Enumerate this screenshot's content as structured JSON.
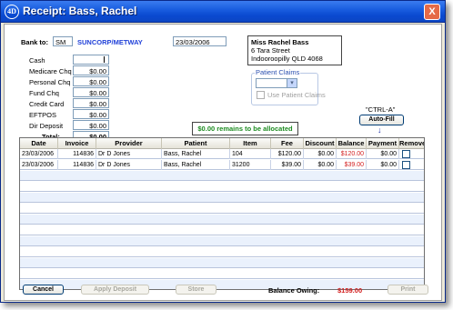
{
  "window": {
    "title": "Receipt: Bass, Rachel",
    "logo": "4D",
    "close_label": "X"
  },
  "bank": {
    "label": "Bank to:",
    "code": "SM",
    "name": "SUNCORP/METWAY",
    "date": "23/03/2006"
  },
  "payment_methods": [
    {
      "label": "Cash",
      "value": ""
    },
    {
      "label": "Medicare Chq",
      "value": "$0.00"
    },
    {
      "label": "Personal Chq",
      "value": "$0.00"
    },
    {
      "label": "Fund Chq",
      "value": "$0.00"
    },
    {
      "label": "Credit Card",
      "value": "$0.00"
    },
    {
      "label": "EFTPOS",
      "value": "$0.00"
    },
    {
      "label": "Dir Deposit",
      "value": "$0.00"
    }
  ],
  "total": {
    "label": "Total:",
    "value": "$0.00"
  },
  "address": {
    "line1": "Miss Rachel Bass",
    "line2": "6 Tara Street",
    "line3": "Indooroopilly QLD 4068"
  },
  "patient_claims": {
    "legend": "Patient Claims",
    "checkbox_label": "Use Patient Claims"
  },
  "remaining": "$0.00 remains to be allocated",
  "autofill": {
    "hint": "\"CTRL-A\"",
    "label": "Auto-Fill",
    "arrow": "↓"
  },
  "grid": {
    "columns": [
      "Date",
      "Invoice",
      "Provider",
      "Patient",
      "Item",
      "Fee",
      "Discount",
      "Balance",
      "Payment",
      "Remove"
    ],
    "rows": [
      {
        "date": "23/03/2006",
        "invoice": "114836",
        "provider": "Dr D Jones",
        "patient": "Bass, Rachel",
        "item": "104",
        "fee": "$120.00",
        "discount": "$0.00",
        "balance": "$120.00",
        "payment": "$0.00"
      },
      {
        "date": "23/03/2006",
        "invoice": "114836",
        "provider": "Dr D Jones",
        "patient": "Bass, Rachel",
        "item": "31200",
        "fee": "$39.00",
        "discount": "$0.00",
        "balance": "$39.00",
        "payment": "$0.00"
      }
    ]
  },
  "buttons": {
    "cancel": "Cancel",
    "apply": "Apply Deposit",
    "store": "Store",
    "print": "Print"
  },
  "balance_owing": {
    "label": "Balance Owing:",
    "value": "$159.00"
  },
  "colors": {
    "title_blue": "#0a49d0",
    "bank_name": "#1e3fd8",
    "remain_green": "#1d8b21",
    "balance_red": "#d32020"
  }
}
